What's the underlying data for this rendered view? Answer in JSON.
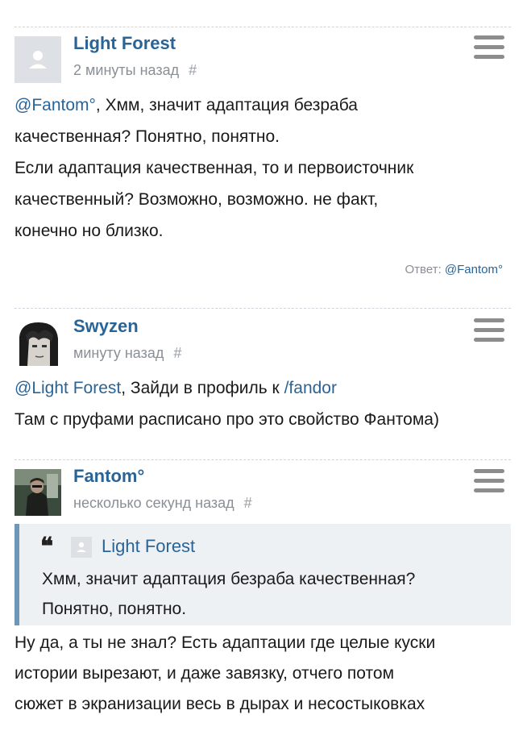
{
  "comments": [
    {
      "author": "Light Forest",
      "time": "2 минуты назад",
      "hash": "#",
      "avatar_icon": "default-user-icon",
      "lines": [
        {
          "mention": "@Fantom°",
          "text": ", Хмм, значит адаптация безраба"
        },
        {
          "text": "качественная? Понятно, понятно."
        },
        {
          "text": "Если адаптация качественная, то и первоисточник"
        },
        {
          "text": "качественный? Возможно, возможно. не факт,"
        },
        {
          "text": "конечно но близко."
        }
      ],
      "reply_label": "Ответ:",
      "reply_to": "@Fantom°"
    },
    {
      "author": "Swyzen",
      "time": "минуту назад",
      "hash": "#",
      "avatar_icon": "anime-avatar",
      "lines": [
        {
          "mention": "@Light Forest",
          "text": ", Зайди в профиль к ",
          "link": "/fandor"
        },
        {
          "text": "Там с пруфами расписано про это свойство Фантома)"
        }
      ]
    },
    {
      "author": "Fantom°",
      "time": "несколько секунд назад",
      "hash": "#",
      "avatar_icon": "photo-avatar",
      "quote": {
        "author": "Light Forest",
        "lines": [
          "Хмм, значит адаптация безраба качественная?",
          "Понятно, понятно."
        ]
      },
      "lines": [
        {
          "text": "Ну да, а ты не знал? Есть адаптации где целые куски"
        },
        {
          "text": "истории вырезают, и даже завязку, отчего потом"
        },
        {
          "text": "сюжет в экранизации весь в дырах и несостыковках"
        }
      ]
    }
  ],
  "colors": {
    "link": "#2a6496",
    "meta": "#8a8f96",
    "quote_bg": "#eef1f4",
    "quote_border": "#6c97b8",
    "menu_icon": "#8c8c8c"
  }
}
